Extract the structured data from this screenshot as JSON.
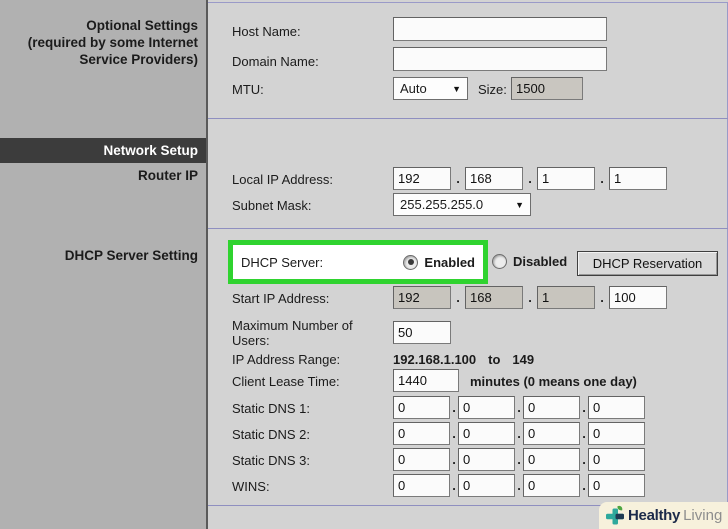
{
  "sidebar": {
    "optional_line1": "Optional Settings",
    "optional_line2": "(required by some Internet",
    "optional_line3": "Service Providers)",
    "network_setup": "Network Setup",
    "router_ip": "Router IP",
    "dhcp_setting": "DHCP Server Setting"
  },
  "optional": {
    "host_label": "Host Name:",
    "host_value": "",
    "domain_label": "Domain Name:",
    "domain_value": "",
    "mtu_label": "MTU:",
    "mtu_selected": "Auto",
    "size_label": "Size:",
    "size_value": "1500"
  },
  "network": {
    "local_ip_label": "Local IP Address:",
    "local_ip": [
      "192",
      "168",
      "1",
      "1"
    ],
    "subnet_label": "Subnet Mask:",
    "subnet_selected": "255.255.255.0"
  },
  "dhcp": {
    "server_label": "DHCP Server:",
    "server_value": "Enabled",
    "enabled": "Enabled",
    "disabled": "Disabled",
    "reservation": "DHCP Reservation",
    "start_ip_label": "Start IP Address:",
    "start_ip": [
      "192",
      "168",
      "1",
      "100"
    ],
    "max_users_label": "Maximum Number of Users:",
    "max_users": "50",
    "range_label": "IP Address Range:",
    "range_start": "192.168.1.100",
    "range_to": "to",
    "range_end": "149",
    "lease_label": "Client Lease Time:",
    "lease_value": "1440",
    "lease_note": "minutes (0 means one day)",
    "dns1_label": "Static DNS 1:",
    "dns1": [
      "0",
      "0",
      "0",
      "0"
    ],
    "dns2_label": "Static DNS 2:",
    "dns2": [
      "0",
      "0",
      "0",
      "0"
    ],
    "dns3_label": "Static DNS 3:",
    "dns3": [
      "0",
      "0",
      "0",
      "0"
    ],
    "wins_label": "WINS:",
    "wins": [
      "0",
      "0",
      "0",
      "0"
    ]
  },
  "watermark": {
    "bold": "Healthy",
    "light": "Living"
  },
  "colors": {
    "sidebar_bg": "#b1b1b1",
    "main_bg": "#d3d3d3",
    "header_bar_bg": "#3c3c3c",
    "divider": "#8f8fc0",
    "highlight_green": "#2fd32f",
    "disabled_field_bg": "#c8c5be",
    "watermark_bg": "#f7f1dc"
  }
}
